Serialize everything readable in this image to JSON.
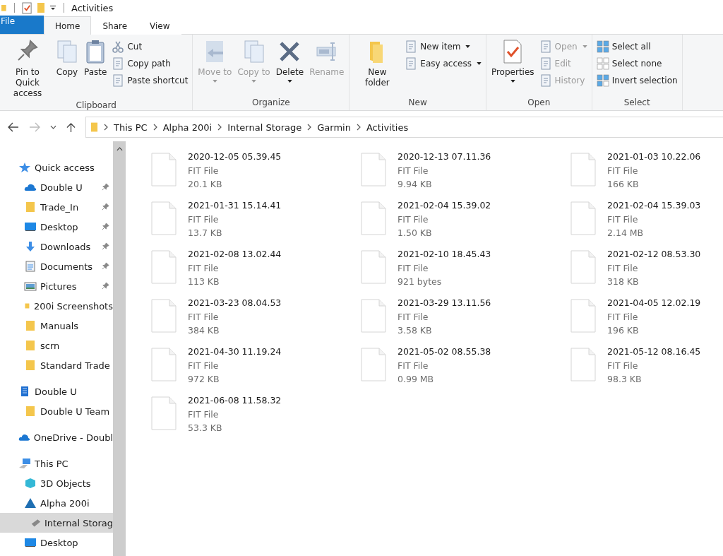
{
  "window": {
    "title": "Activities"
  },
  "ribbon_tabs": [
    {
      "label": "File",
      "kind": "file",
      "selected": false
    },
    {
      "label": "Home",
      "kind": "tab",
      "selected": true
    },
    {
      "label": "Share",
      "kind": "tab",
      "selected": false
    },
    {
      "label": "View",
      "kind": "tab",
      "selected": false
    }
  ],
  "ribbon_groups": [
    {
      "label": "Clipboard",
      "items": [
        {
          "label": "Pin to Quick access",
          "kind": "large",
          "disabled": false,
          "dropdown": false
        },
        {
          "label": "Copy",
          "kind": "large",
          "disabled": false,
          "dropdown": false
        },
        {
          "label": "Paste",
          "kind": "large",
          "disabled": false,
          "dropdown": false
        },
        {
          "label": "Cut",
          "kind": "small",
          "disabled": false,
          "dropdown": false
        },
        {
          "label": "Copy path",
          "kind": "small",
          "disabled": false,
          "dropdown": false
        },
        {
          "label": "Paste shortcut",
          "kind": "small",
          "disabled": false,
          "dropdown": false
        }
      ]
    },
    {
      "label": "Organize",
      "items": [
        {
          "label": "Move to",
          "kind": "large",
          "disabled": true,
          "dropdown": true
        },
        {
          "label": "Copy to",
          "kind": "large",
          "disabled": true,
          "dropdown": true
        },
        {
          "label": "Delete",
          "kind": "large",
          "disabled": false,
          "dropdown": true
        },
        {
          "label": "Rename",
          "kind": "large",
          "disabled": true,
          "dropdown": false
        }
      ]
    },
    {
      "label": "New",
      "items": [
        {
          "label": "New folder",
          "kind": "large",
          "disabled": false,
          "dropdown": false
        },
        {
          "label": "New item",
          "kind": "small",
          "disabled": false,
          "dropdown": true
        },
        {
          "label": "Easy access",
          "kind": "small",
          "disabled": false,
          "dropdown": true
        }
      ]
    },
    {
      "label": "Open",
      "items": [
        {
          "label": "Properties",
          "kind": "large",
          "disabled": false,
          "dropdown": true
        },
        {
          "label": "Open",
          "kind": "small",
          "disabled": true,
          "dropdown": true
        },
        {
          "label": "Edit",
          "kind": "small",
          "disabled": true,
          "dropdown": false
        },
        {
          "label": "History",
          "kind": "small",
          "disabled": true,
          "dropdown": false
        }
      ]
    },
    {
      "label": "Select",
      "items": [
        {
          "label": "Select all",
          "kind": "small",
          "disabled": false,
          "dropdown": false
        },
        {
          "label": "Select none",
          "kind": "small",
          "disabled": false,
          "dropdown": false
        },
        {
          "label": "Invert selection",
          "kind": "small",
          "disabled": false,
          "dropdown": false
        }
      ]
    }
  ],
  "address_bar": {
    "path": [
      "This PC",
      "Alpha 200i",
      "Internal Storage",
      "Garmin",
      "Activities"
    ]
  },
  "sidebar": {
    "items": [
      {
        "label": "Quick access",
        "pinned": false,
        "selected": false,
        "children": [
          {
            "label": "Double U",
            "pinned": true,
            "selected": false
          },
          {
            "label": "Trade_In",
            "pinned": true,
            "selected": false
          },
          {
            "label": "Desktop",
            "pinned": true,
            "selected": false
          },
          {
            "label": "Downloads",
            "pinned": true,
            "selected": false
          },
          {
            "label": "Documents",
            "pinned": true,
            "selected": false
          },
          {
            "label": "Pictures",
            "pinned": true,
            "selected": false
          },
          {
            "label": "200i Screenshots",
            "pinned": false,
            "selected": false
          },
          {
            "label": "Manuals",
            "pinned": false,
            "selected": false
          },
          {
            "label": "scrn",
            "pinned": false,
            "selected": false
          },
          {
            "label": "Standard Trade",
            "pinned": false,
            "selected": false
          }
        ]
      },
      {
        "label": "Double U",
        "pinned": false,
        "selected": false,
        "children": [
          {
            "label": "Double U Team",
            "pinned": false,
            "selected": false
          }
        ]
      },
      {
        "label": "OneDrive - Doubl",
        "pinned": false,
        "selected": false
      },
      {
        "label": "This PC",
        "pinned": false,
        "selected": false,
        "children": [
          {
            "label": "3D Objects",
            "pinned": false,
            "selected": false
          },
          {
            "label": "Alpha 200i",
            "pinned": false,
            "selected": false,
            "children": [
              {
                "label": "Internal Storag",
                "pinned": false,
                "selected": true
              }
            ]
          },
          {
            "label": "Desktop",
            "pinned": false,
            "selected": false
          }
        ]
      }
    ]
  },
  "files": [
    {
      "name": "2020-12-05 05.39.45",
      "type": "FIT File",
      "size": "20.1 KB"
    },
    {
      "name": "2020-12-13 07.11.36",
      "type": "FIT File",
      "size": "9.94 KB"
    },
    {
      "name": "2021-01-03 10.22.06",
      "type": "FIT File",
      "size": "166 KB"
    },
    {
      "name": "2021-01-31 15.14.41",
      "type": "FIT File",
      "size": "13.7 KB"
    },
    {
      "name": "2021-02-04 15.39.02",
      "type": "FIT File",
      "size": "1.50 KB"
    },
    {
      "name": "2021-02-04 15.39.03",
      "type": "FIT File",
      "size": "2.14 MB"
    },
    {
      "name": "2021-02-08 13.02.44",
      "type": "FIT File",
      "size": "113 KB"
    },
    {
      "name": "2021-02-10 18.45.43",
      "type": "FIT File",
      "size": "921 bytes"
    },
    {
      "name": "2021-02-12 08.53.30",
      "type": "FIT File",
      "size": "318 KB"
    },
    {
      "name": "2021-03-23 08.04.53",
      "type": "FIT File",
      "size": "384 KB"
    },
    {
      "name": "2021-03-29 13.11.56",
      "type": "FIT File",
      "size": "3.58 KB"
    },
    {
      "name": "2021-04-05 12.02.19",
      "type": "FIT File",
      "size": "196 KB"
    },
    {
      "name": "2021-04-30 11.19.24",
      "type": "FIT File",
      "size": "972 KB"
    },
    {
      "name": "2021-05-02 08.55.38",
      "type": "FIT File",
      "size": "0.99 MB"
    },
    {
      "name": "2021-05-12 08.16.45",
      "type": "FIT File",
      "size": "98.3 KB"
    },
    {
      "name": "2021-06-08 11.58.32",
      "type": "FIT File",
      "size": "53.3 KB"
    }
  ]
}
